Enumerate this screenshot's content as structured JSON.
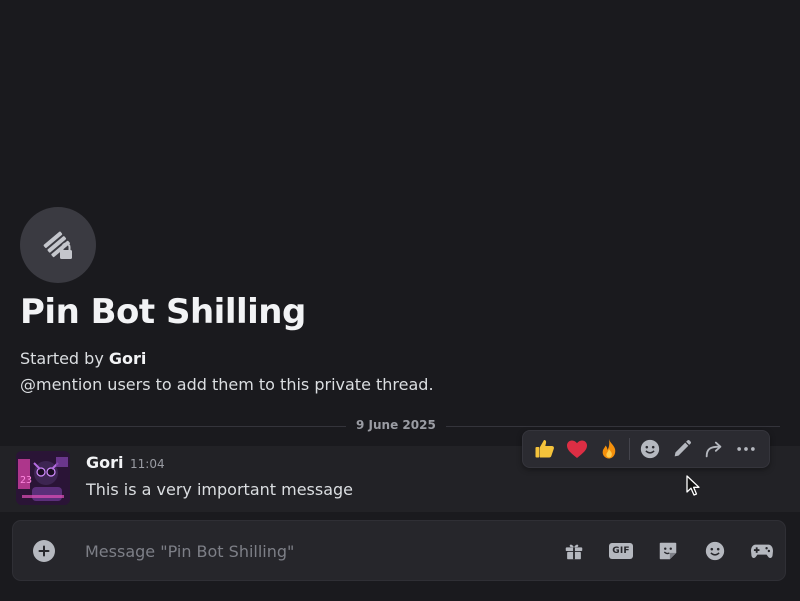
{
  "thread": {
    "title": "Pin Bot Shilling",
    "started_by_prefix": "Started by",
    "started_by_user": "Gori",
    "hint": "@mention users to add them to this private thread."
  },
  "divider": {
    "date": "9 June 2025"
  },
  "message": {
    "author": "Gori",
    "time": "11:04",
    "text": "This is a very important message"
  },
  "toolbar": {
    "reactions": [
      "👍",
      "❤️",
      "🔥"
    ],
    "actions": [
      "add-reaction-icon",
      "edit-icon",
      "forward-icon",
      "more-icon"
    ]
  },
  "composer": {
    "placeholder": "Message \"Pin Bot Shilling\"",
    "gif_label": "GIF",
    "icons": [
      "gift-icon",
      "gif-icon",
      "sticker-icon",
      "emoji-icon",
      "activity-icon"
    ]
  },
  "colors": {
    "background": "#1a1a1e",
    "message_hover": "#222226",
    "composer": "#26262b",
    "text": "#dbdee1",
    "muted": "#9a9ca3"
  }
}
